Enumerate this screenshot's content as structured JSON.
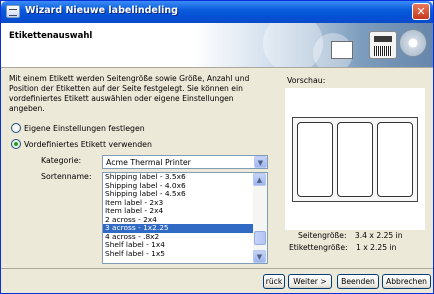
{
  "window": {
    "title": "Wizard Nieuwe labelindeling",
    "close_glyph": "✕"
  },
  "header": {
    "title": "Etikettenauswahl"
  },
  "intro_text": "Mit einem Etikett werden Seitengröße sowie Größe, Anzahl und Position der Etiketten auf der Seite festgelegt. Sie können ein vordefiniertes Etikett auswählen oder eigene Einstellungen angeben.",
  "options": {
    "own_settings": "Eigene Einstellungen festlegen",
    "predefined": "Vordefiniertes Etikett verwenden",
    "selected": "predefined"
  },
  "category": {
    "label": "Kategorie:",
    "value": "Acme Thermal Printer"
  },
  "sort": {
    "label": "Sortenname:",
    "items": [
      "Shipping label - 3.5x6",
      "Shipping label - 4.0x6",
      "Shipping label - 4.5x6",
      "Item label - 2x3",
      "Item label - 2x4",
      "2 across - 2x4",
      "3 across - 1x2.25",
      "4 across - .8x2",
      "Shelf label - 1x4",
      "Shelf label - 1x5"
    ],
    "selected_index": 6
  },
  "preview": {
    "label": "Vorschau:",
    "page_size_label": "Seitengröße:",
    "page_size_value": "3.4 x 2.25 in",
    "label_size_label": "Etikettengröße:",
    "label_size_value": "1 x 2.25 in"
  },
  "buttons": {
    "back": "< Zurück",
    "back_visible": "rück",
    "next": "Weiter >",
    "finish": "Beenden",
    "cancel": "Abbrechen"
  },
  "colors": {
    "title_bar": "#0b5ddc",
    "selection": "#316ac5",
    "dialog_bg": "#ece9d8"
  }
}
